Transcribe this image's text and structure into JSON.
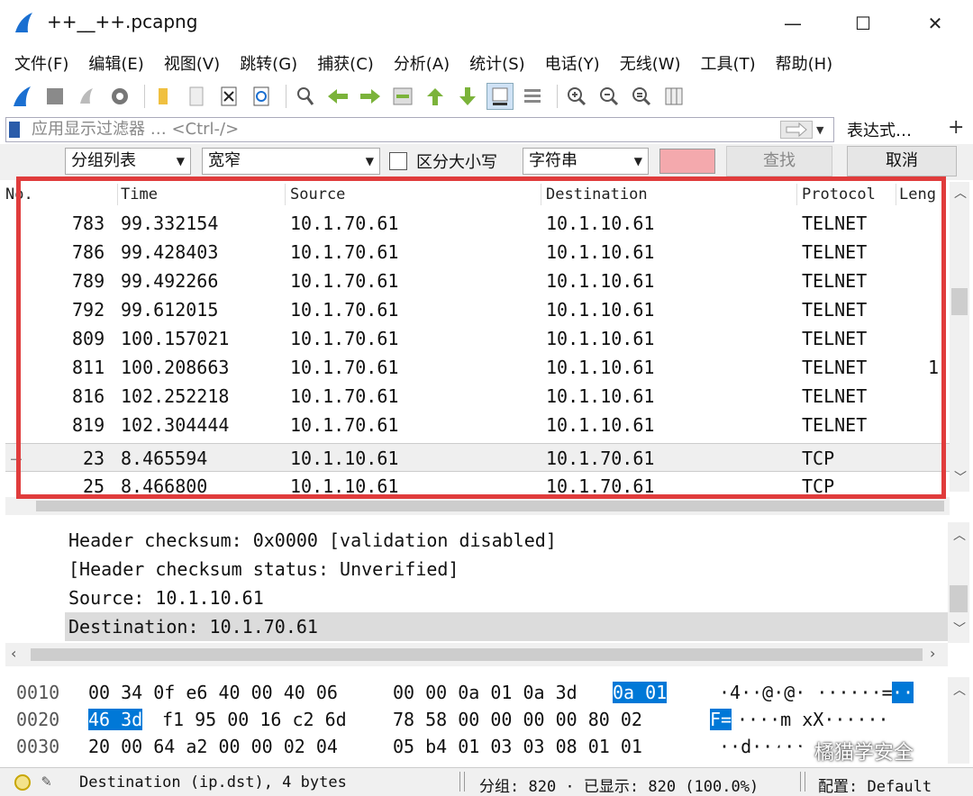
{
  "window": {
    "title": "++__++.pcapng",
    "minimize": "—",
    "maximize": "☐",
    "close": "✕"
  },
  "menu": [
    "文件(F)",
    "编辑(E)",
    "视图(V)",
    "跳转(G)",
    "捕获(C)",
    "分析(A)",
    "统计(S)",
    "电话(Y)",
    "无线(W)",
    "工具(T)",
    "帮助(H)"
  ],
  "toolbar": {
    "icons": [
      "shark-fin-icon",
      "stop-icon",
      "restart-icon",
      "options-gear-icon",
      "open-folder-icon",
      "file-icon",
      "close-file-icon",
      "reload-icon",
      "find-packet-icon",
      "back-arrow-icon",
      "forward-arrow-icon",
      "goto-packet-icon",
      "first-packet-icon",
      "last-packet-icon",
      "autoscroll-icon",
      "colorize-icon",
      "zoom-in-icon",
      "zoom-out-icon",
      "zoom-reset-icon",
      "resize-columns-icon"
    ]
  },
  "filter": {
    "placeholder": "应用显示过滤器 … <Ctrl-/>",
    "expression_label": "表达式…",
    "plus": "+"
  },
  "search": {
    "scope": "分组列表",
    "width": "宽窄",
    "case_label": "区分大小写",
    "type": "字符串",
    "find_label": "查找",
    "cancel_label": "取消",
    "highlight_color": "#f4a9ad"
  },
  "packet_list": {
    "columns": [
      "No.",
      "Time",
      "Source",
      "Destination",
      "Protocol",
      "Leng"
    ],
    "rows": [
      {
        "no": "783",
        "time": "99.332154",
        "source": "10.1.70.61",
        "destination": "10.1.10.61",
        "protocol": "TELNET",
        "length": ""
      },
      {
        "no": "786",
        "time": "99.428403",
        "source": "10.1.70.61",
        "destination": "10.1.10.61",
        "protocol": "TELNET",
        "length": ""
      },
      {
        "no": "789",
        "time": "99.492266",
        "source": "10.1.70.61",
        "destination": "10.1.10.61",
        "protocol": "TELNET",
        "length": ""
      },
      {
        "no": "792",
        "time": "99.612015",
        "source": "10.1.70.61",
        "destination": "10.1.10.61",
        "protocol": "TELNET",
        "length": ""
      },
      {
        "no": "809",
        "time": "100.157021",
        "source": "10.1.70.61",
        "destination": "10.1.10.61",
        "protocol": "TELNET",
        "length": ""
      },
      {
        "no": "811",
        "time": "100.208663",
        "source": "10.1.70.61",
        "destination": "10.1.10.61",
        "protocol": "TELNET",
        "length": "1"
      },
      {
        "no": "816",
        "time": "102.252218",
        "source": "10.1.70.61",
        "destination": "10.1.10.61",
        "protocol": "TELNET",
        "length": ""
      },
      {
        "no": "819",
        "time": "102.304444",
        "source": "10.1.70.61",
        "destination": "10.1.10.61",
        "protocol": "TELNET",
        "length": ""
      },
      {
        "no": "23",
        "time": "8.465594",
        "source": "10.1.10.61",
        "destination": "10.1.70.61",
        "protocol": "TCP",
        "length": ""
      },
      {
        "no": "25",
        "time": "8.466800",
        "source": "10.1.10.61",
        "destination": "10.1.70.61",
        "protocol": "TCP",
        "length": ""
      }
    ]
  },
  "details": [
    "Header checksum: 0x0000 [validation disabled]",
    "[Header checksum status: Unverified]",
    "Source: 10.1.10.61",
    "Destination: 10.1.70.61"
  ],
  "bytes": [
    {
      "offset": "0010",
      "hex1": "00 34 0f e6 40 00 40 06",
      "hex2a": "00 00 0a 01 0a 3d",
      "hex2b": "0a 01",
      "ascii_a": "·4··@·@· ······=",
      "ascii_b": "··"
    },
    {
      "offset": "0020",
      "hex1a": "46 3d",
      "hex1b": "f1 95 00 16 c2 6d",
      "hex2": "78 58 00 00 00 00 80 02",
      "ascii_a": "F=",
      "ascii_b": "····m xX······"
    },
    {
      "offset": "0030",
      "hex1": "20 00 64 a2 00 00 02 04",
      "hex2": "05 b4 01 03 03 08 01 01",
      "ascii": "··d·····"
    }
  ],
  "watermark": "橘猫学安全",
  "status": {
    "field": "Destination (ip.dst), 4 bytes",
    "counts": "分组: 820 · 已显示: 820 (100.0%)",
    "profile": "配置: Default"
  }
}
